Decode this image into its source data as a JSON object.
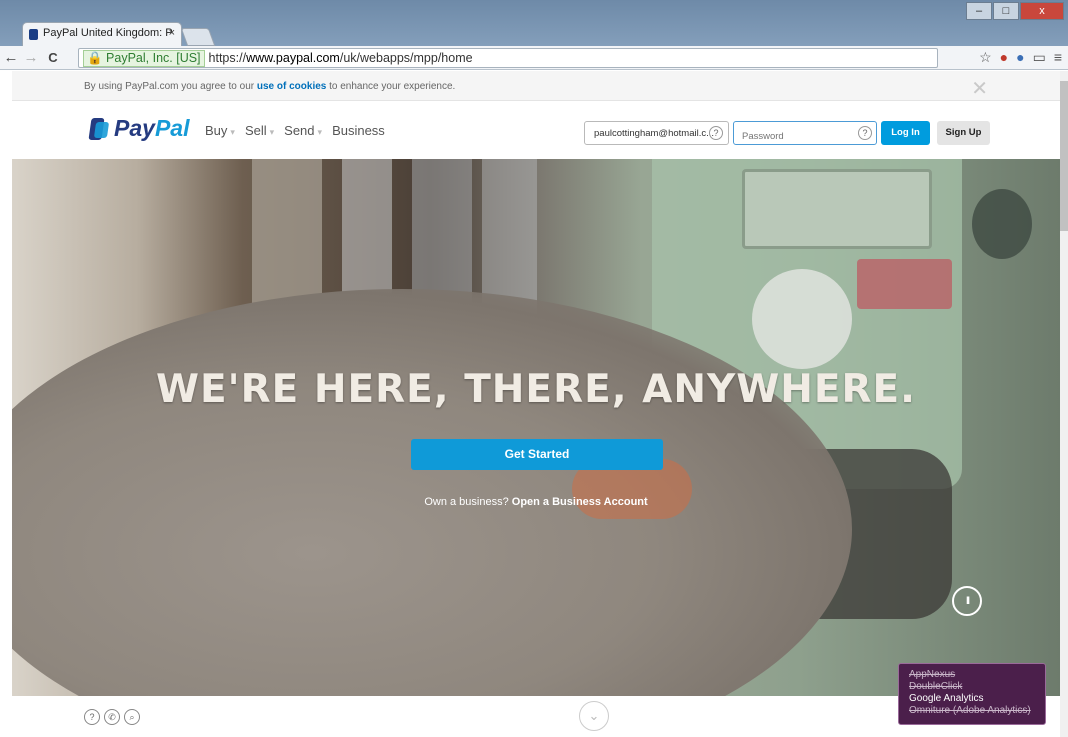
{
  "browser": {
    "tab_title": "PayPal United Kingdom: P",
    "tab_close": "×",
    "window_buttons": {
      "minimize": "–",
      "maximize": "□",
      "close": "x"
    },
    "ev_label": "PayPal, Inc. [US]",
    "url_prefix": "https://",
    "url_domain": "www.paypal.com",
    "url_path": "/uk/webapps/mpp/home",
    "nav": {
      "back": "←",
      "forward": "→",
      "reload": "C"
    },
    "toolbar_icons": {
      "star": "☆",
      "menu": "≡"
    }
  },
  "cookie_banner": {
    "text_before": "By using PayPal.com you agree to our ",
    "link": "use of cookies",
    "text_after": " to enhance your experience.",
    "close": "✕"
  },
  "header": {
    "logo_pay": "Pay",
    "logo_pal": "Pal",
    "nav": [
      {
        "label": "Buy",
        "caret": "▾"
      },
      {
        "label": "Sell",
        "caret": "▾"
      },
      {
        "label": "Send",
        "caret": "▾"
      },
      {
        "label": "Business"
      }
    ],
    "email_value": "paulcottingham@hotmail.c...",
    "password_placeholder": "Password",
    "help_icon": "?",
    "login_label": "Log In",
    "signup_label": "Sign Up"
  },
  "hero": {
    "headline": "WE'RE HERE, THERE, ANYWHERE.",
    "cta_label": "Get Started",
    "sub_text": "Own a business? ",
    "sub_link": "Open a Business Account",
    "pause_icon": "II"
  },
  "footer": {
    "icons": {
      "help": "?",
      "phone": "✆",
      "search": "⌕"
    },
    "scroll_down": "⌄"
  },
  "ghostery": {
    "trackers": [
      {
        "name": "AppNexus",
        "blocked": true
      },
      {
        "name": "DoubleClick",
        "blocked": true
      },
      {
        "name": "Google Analytics",
        "blocked": false
      },
      {
        "name": "Omniture (Adobe Analytics)",
        "blocked": true
      }
    ]
  },
  "colors": {
    "paypal_dark": "#253b80",
    "paypal_light": "#179bd7",
    "cta_blue": "#0f9ad8",
    "ghostery_bg": "#4b1f4b"
  }
}
